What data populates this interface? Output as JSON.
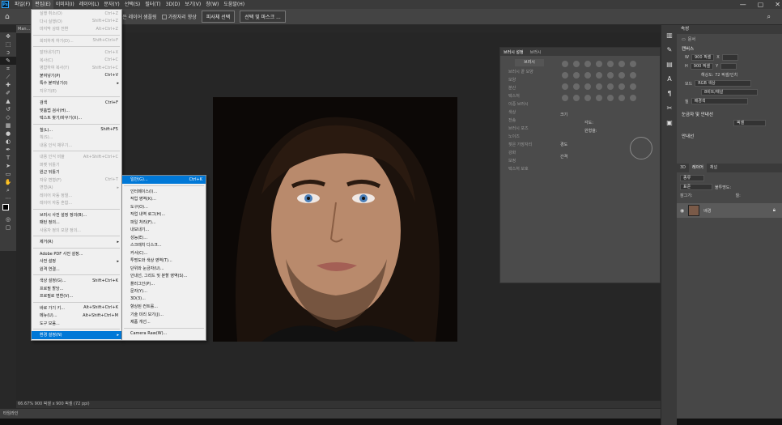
{
  "app_icon": "Ps",
  "menubar": [
    "파일(F)",
    "편집(E)",
    "이미지(I)",
    "레이어(L)",
    "문자(Y)",
    "선택(S)",
    "필터(T)",
    "3D(D)",
    "보기(V)",
    "창(W)",
    "도움말(H)"
  ],
  "window_controls": [
    "—",
    "▢",
    "✕"
  ],
  "options": {
    "check1": "모든 레이어 샘플링",
    "check2": "가장자리 향상",
    "btn1": "피사체 선택",
    "btn2": "선택 및 마스크 ..."
  },
  "doc_tab": "Man...",
  "status": "66.67%  900 픽셀 x 900 픽셀 (72 ppi)",
  "timeline": "타임라인",
  "edit_menu": [
    {
      "l": "실행 취소(O)",
      "s": "Ctrl+Z",
      "d": true
    },
    {
      "l": "다시 실행(O)",
      "s": "Shift+Ctrl+Z",
      "d": true
    },
    {
      "l": "마지막 상태 전환",
      "s": "Alt+Ctrl+Z",
      "d": true
    },
    {
      "sep": true
    },
    {
      "l": "희미하게 하기(D)...",
      "s": "Shift+Ctrl+F",
      "d": true
    },
    {
      "sep": true
    },
    {
      "l": "잘라내기(T)",
      "s": "Ctrl+X",
      "d": true
    },
    {
      "l": "복사(C)",
      "s": "Ctrl+C",
      "d": true
    },
    {
      "l": "병합하여 복사(Y)",
      "s": "Shift+Ctrl+C",
      "d": true
    },
    {
      "l": "붙여넣기(P)",
      "s": "Ctrl+V",
      "d": false
    },
    {
      "l": "특수 붙여넣기(I)",
      "s": "",
      "d": false,
      "sub": true
    },
    {
      "l": "지우기(E)",
      "s": "",
      "d": true
    },
    {
      "sep": true
    },
    {
      "l": "검색",
      "s": "Ctrl+F",
      "d": false
    },
    {
      "l": "맞춤법 검사(H)...",
      "s": "",
      "d": false
    },
    {
      "l": "텍스트 찾기/바꾸기(X)...",
      "s": "",
      "d": false
    },
    {
      "sep": true
    },
    {
      "l": "칠(L)...",
      "s": "Shift+F5",
      "d": false
    },
    {
      "l": "획(S)...",
      "s": "",
      "d": true
    },
    {
      "l": "내용 인식 채우기...",
      "s": "",
      "d": true
    },
    {
      "sep": true
    },
    {
      "l": "내용 인식 비율",
      "s": "Alt+Shift+Ctrl+C",
      "d": true
    },
    {
      "l": "퍼펫 뒤틀기",
      "s": "",
      "d": true
    },
    {
      "l": "원근 뒤틀기",
      "s": "",
      "d": false
    },
    {
      "l": "자유 변형(F)",
      "s": "Ctrl+T",
      "d": true
    },
    {
      "l": "변형(A)",
      "s": "",
      "d": true,
      "sub": true
    },
    {
      "l": "레이어 자동 정렬...",
      "s": "",
      "d": true
    },
    {
      "l": "레이어 자동 혼합...",
      "s": "",
      "d": true
    },
    {
      "sep": true
    },
    {
      "l": "브러시 사전 설정 정의(B)...",
      "s": "",
      "d": false
    },
    {
      "l": "패턴 정의...",
      "s": "",
      "d": false
    },
    {
      "l": "사용자 정의 모양 정의...",
      "s": "",
      "d": true
    },
    {
      "sep": true
    },
    {
      "l": "제거(R)",
      "s": "",
      "d": false,
      "sub": true
    },
    {
      "sep": true
    },
    {
      "l": "Adobe PDF 사전 설정...",
      "s": "",
      "d": false
    },
    {
      "l": "사전 설정",
      "s": "",
      "d": false,
      "sub": true
    },
    {
      "l": "원격 연결...",
      "s": "",
      "d": false
    },
    {
      "sep": true
    },
    {
      "l": "색상 설정(G)...",
      "s": "Shift+Ctrl+K",
      "d": false
    },
    {
      "l": "프로필 할당...",
      "s": "",
      "d": false
    },
    {
      "l": "프로필로 변환(V)...",
      "s": "",
      "d": false
    },
    {
      "sep": true
    },
    {
      "l": "바로 가기 키...",
      "s": "Alt+Shift+Ctrl+K",
      "d": false
    },
    {
      "l": "메뉴(U)...",
      "s": "Alt+Shift+Ctrl+M",
      "d": false
    },
    {
      "l": "도구 모음...",
      "s": "",
      "d": false
    },
    {
      "sep": true
    },
    {
      "l": "환경 설정(N)",
      "s": "",
      "d": false,
      "sub": true,
      "hl": true
    }
  ],
  "pref_submenu": [
    {
      "l": "일반(G)...",
      "s": "Ctrl+K",
      "hl": true
    },
    {
      "sep": true
    },
    {
      "l": "인터페이스(I)..."
    },
    {
      "l": "작업 영역(K)..."
    },
    {
      "l": "도구(O)..."
    },
    {
      "l": "작업 내역 로그(H)..."
    },
    {
      "l": "파일 처리(F)..."
    },
    {
      "l": "내보내기..."
    },
    {
      "l": "성능(E)..."
    },
    {
      "l": "스크래치 디스크..."
    },
    {
      "l": "커서(C)..."
    },
    {
      "l": "투명도와 색상 영역(T)..."
    },
    {
      "l": "단위와 눈금자(U)..."
    },
    {
      "l": "안내선, 그리드 및 분할 영역(S)..."
    },
    {
      "l": "플러그인(P)..."
    },
    {
      "l": "문자(Y)..."
    },
    {
      "l": "3D(3)..."
    },
    {
      "l": "향상된 컨트롤..."
    },
    {
      "l": "기술 미리 보기(J)..."
    },
    {
      "l": "제품 개선..."
    },
    {
      "sep": true
    },
    {
      "l": "Camera Raw(W)..."
    }
  ],
  "brush_panel": {
    "tab1": "브러시 설정",
    "tab2": "브러시",
    "btn": "브러시",
    "items": [
      "브러시 끝 모양",
      "모양",
      "분산",
      "텍스처",
      "이중 브러시",
      "색상",
      "전송",
      "브러시 포즈",
      "노이즈",
      "젖은 가장자리",
      "강화",
      "보정",
      "텍스처 보호"
    ],
    "size": "크기",
    "angle": "각도:",
    "round": "원형율:",
    "hardness": "경도",
    "spacing": "간격"
  },
  "props": {
    "tab": "속성",
    "doc": "문서",
    "canvas": "캔버스",
    "w": "900 픽셀",
    "h": "900 픽셀",
    "x": "X",
    "y": "Y",
    "res": "해상도: 72 픽셀/인치",
    "mode_label": "모드",
    "mode": "RGB 색상",
    "bits": "8비트/채널",
    "fill_label": "칠",
    "fill": "배경색",
    "rulers": "눈금자 및 안내선",
    "unit": "픽셀",
    "guides": "안내선"
  },
  "layers": {
    "tab1": "3D",
    "tab2": "레이어",
    "tab3": "채널",
    "kind": "종류",
    "normal": "표준",
    "opacity": "불투명도:",
    "lock": "잠그기:",
    "fill": "칠:",
    "layer_name": "배경"
  }
}
